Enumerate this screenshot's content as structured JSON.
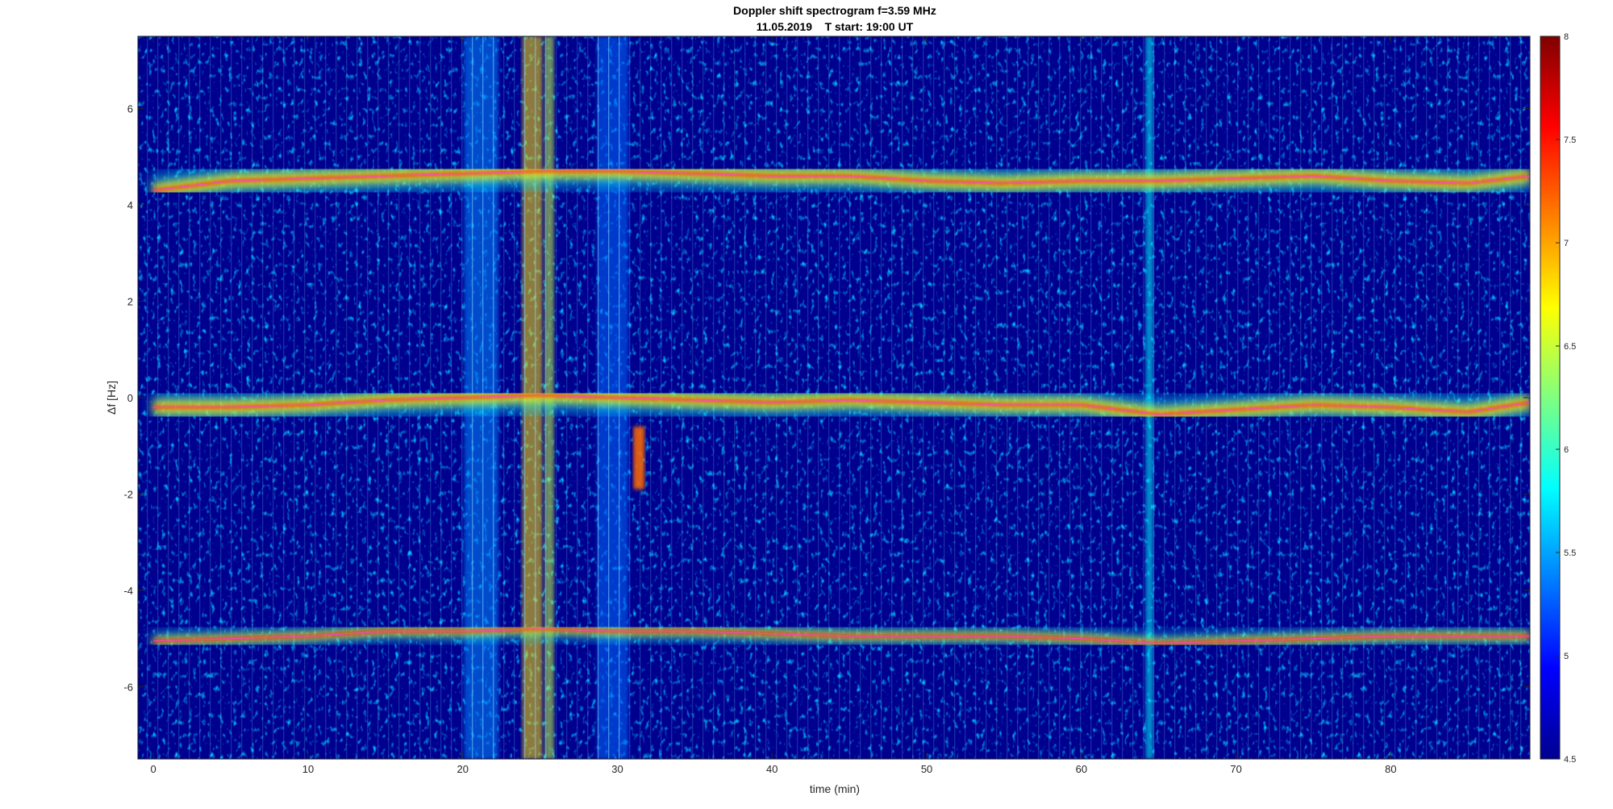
{
  "chart_data": {
    "type": "heatmap",
    "title": "Doppler shift spectrogram f=3.59 MHz",
    "subtitle": "11.05.2019    T start: 19:00 UT",
    "xlabel": "time (min)",
    "ylabel": "Δf [Hz]",
    "xlim": [
      -1,
      89
    ],
    "ylim": [
      -7.5,
      7.5
    ],
    "xticks": [
      0,
      10,
      20,
      30,
      40,
      50,
      60,
      70,
      80
    ],
    "yticks": [
      6,
      4,
      2,
      0,
      -2,
      -4,
      -6
    ],
    "colorbar": {
      "colormap": "jet",
      "clim": [
        4.5,
        8
      ],
      "ticks": [
        8,
        7.5,
        7,
        6.5,
        6,
        5.5,
        5,
        4.5
      ]
    },
    "traces": [
      {
        "name": "",
        "x": [
          0,
          5,
          10,
          15,
          20,
          25,
          30,
          35,
          40,
          45,
          50,
          55,
          60,
          65,
          70,
          75,
          80,
          85,
          89
        ],
        "y": [
          4.3,
          4.5,
          4.55,
          4.6,
          4.65,
          4.7,
          4.7,
          4.65,
          4.6,
          4.6,
          4.5,
          4.45,
          4.5,
          4.5,
          4.55,
          4.6,
          4.5,
          4.45,
          4.6
        ]
      },
      {
        "name": "",
        "x": [
          0,
          5,
          10,
          15,
          20,
          25,
          30,
          35,
          40,
          45,
          50,
          55,
          60,
          65,
          70,
          75,
          80,
          85,
          89
        ],
        "y": [
          -0.2,
          -0.2,
          -0.15,
          -0.05,
          0.0,
          0.05,
          0.0,
          -0.05,
          -0.1,
          -0.05,
          -0.1,
          -0.15,
          -0.15,
          -0.35,
          -0.25,
          -0.15,
          -0.2,
          -0.3,
          -0.1
        ]
      },
      {
        "name": "",
        "x": [
          0,
          5,
          10,
          15,
          20,
          25,
          30,
          35,
          40,
          45,
          50,
          55,
          60,
          65,
          70,
          75,
          80,
          85,
          89
        ],
        "y": [
          -5.05,
          -5.0,
          -4.95,
          -4.85,
          -4.85,
          -4.8,
          -4.85,
          -4.85,
          -4.9,
          -4.95,
          -4.95,
          -4.95,
          -5.0,
          -5.1,
          -5.05,
          -5.0,
          -4.95,
          -4.95,
          -4.95
        ]
      }
    ],
    "vertical_bursts": [
      {
        "x": 24.5,
        "width_min": 1.3,
        "intensity": 6.8
      },
      {
        "x": 25.6,
        "width_min": 0.6,
        "intensity": 6.5
      },
      {
        "x": 64.4,
        "width_min": 0.5,
        "intensity": 5.8
      },
      {
        "x": 21.2,
        "width_min": 2.2,
        "intensity": 5.4
      },
      {
        "x": 29.7,
        "width_min": 2.0,
        "intensity": 5.3
      }
    ],
    "spots": [
      {
        "x": 31.4,
        "y_top": -0.6,
        "y_bottom": -1.9,
        "intensity": 7.2
      }
    ],
    "grid": false,
    "colors": {
      "background": "#00008f",
      "line_overlay": "#ff40ff",
      "black_overlay": "#000000"
    }
  }
}
